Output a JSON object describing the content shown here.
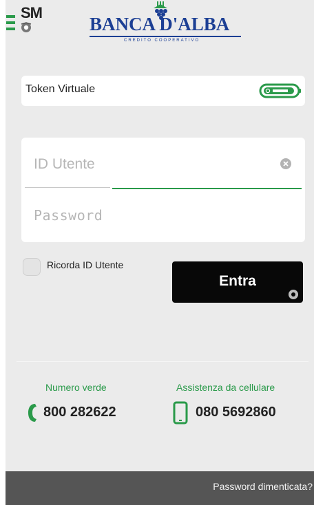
{
  "header": {
    "sm_logo_text": "SM",
    "bank_name": "BANCA D'ALBA",
    "bank_tagline": "CREDITO   COOPERATIVO"
  },
  "token": {
    "label": "Token Virtuale"
  },
  "login": {
    "user_placeholder": "ID Utente",
    "password_placeholder": "Password"
  },
  "remember": {
    "label": "Ricorda ID Utente",
    "checked": false
  },
  "submit": {
    "label": "Entra"
  },
  "contacts": {
    "toll_free_label": "Numero verde",
    "toll_free_number": "800 282622",
    "mobile_label": "Assistenza da cellulare",
    "mobile_number": "080 5692860"
  },
  "footer": {
    "forgot_password": "Password dimenticata?"
  },
  "colors": {
    "accent_green": "#2a9a4a",
    "bank_blue": "#1c3f94",
    "background": "#ebebeb",
    "button_black": "#080808",
    "footer_gray": "#555555"
  },
  "icons": {
    "menu": "hamburger-icon",
    "clear": "clear-icon",
    "token": "token-device-icon",
    "phone": "phone-icon",
    "mobile": "smartphone-icon"
  }
}
